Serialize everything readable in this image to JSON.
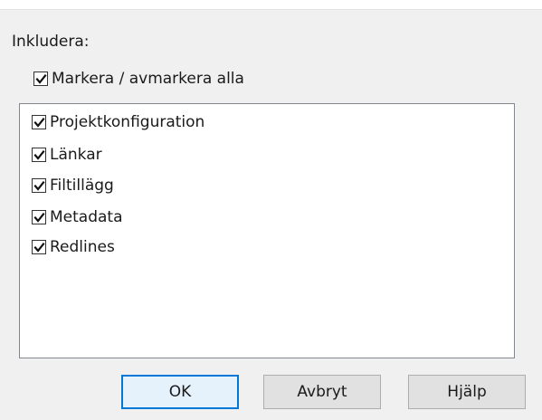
{
  "dialog": {
    "include_label": "Inkludera:",
    "select_all": {
      "label": "Markera / avmarkera alla",
      "checked": true
    },
    "items": [
      {
        "label": "Projektkonfiguration",
        "checked": true
      },
      {
        "label": "Länkar",
        "checked": true
      },
      {
        "label": "Filtillägg",
        "checked": true
      },
      {
        "label": "Metadata",
        "checked": true
      },
      {
        "label": "Redlines",
        "checked": true
      }
    ],
    "buttons": {
      "ok": "OK",
      "cancel": "Avbryt",
      "help_first": "H",
      "help_underlined": "j",
      "help_rest": "älp"
    }
  }
}
